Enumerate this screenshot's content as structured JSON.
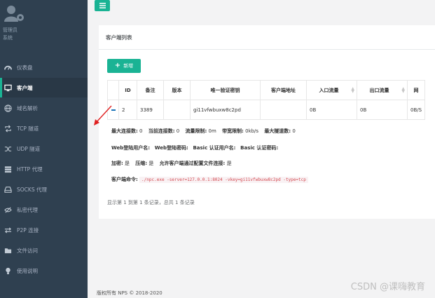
{
  "sidebar": {
    "user_name": "管理员",
    "user_role": "系统",
    "items": [
      {
        "label": "仪表盘",
        "icon": "dashboard-icon"
      },
      {
        "label": "客户端",
        "icon": "desktop-icon",
        "active": true
      },
      {
        "label": "域名解析",
        "icon": "globe-icon"
      },
      {
        "label": "TCP 隧道",
        "icon": "retweet-icon"
      },
      {
        "label": "UDP 隧道",
        "icon": "random-icon"
      },
      {
        "label": "HTTP 代理",
        "icon": "server-icon"
      },
      {
        "label": "SOCKS 代理",
        "icon": "hdd-icon"
      },
      {
        "label": "私密代理",
        "icon": "eye-slash-icon"
      },
      {
        "label": "P2P 连接",
        "icon": "exchange-icon"
      },
      {
        "label": "文件访问",
        "icon": "folder-icon"
      },
      {
        "label": "使用说明",
        "icon": "lightbulb-icon"
      }
    ]
  },
  "panel": {
    "title": "客户端列表",
    "add_label": "新增",
    "columns": [
      "ID",
      "备注",
      "版本",
      "唯一验证密钥",
      "客户端地址",
      "入口流量",
      "出口流量",
      "网"
    ],
    "row": {
      "id": "2",
      "remark": "3389",
      "version": "",
      "vkey": "gi11vfwbuxw8c2pd",
      "address": "",
      "inlet": "0B",
      "outlet": "0B",
      "speed": "0B/S"
    },
    "detail": {
      "max_conn_label": "最大连接数:",
      "max_conn": "0",
      "cur_conn_label": "当前连接数:",
      "cur_conn": "0",
      "flow_limit_label": "流量限制:",
      "flow_limit": "0m",
      "rate_limit_label": "带宽限制:",
      "rate_limit": "0kb/s",
      "max_tunnel_label": "最大隧道数:",
      "max_tunnel": "0",
      "web_user_label": "Web登陆用户名:",
      "web_pass_label": "Web登陆密码:",
      "basic_user_label": "Basic 认证用户名:",
      "basic_pass_label": "Basic 认证密码:",
      "encrypt_label": "加密:",
      "encrypt": "是",
      "compress_label": "压缩:",
      "compress": "是",
      "config_conn_label": "允许客户端通过配置文件连接:",
      "config_conn": "是",
      "cmd_label": "客户端命令:",
      "cmd": "./npc.exe -server=127.0.0.1:8024 -vkey=gi11vfwbuxw8c2pd -type=tcp"
    },
    "summary": "显示第 1 到第 1 条记录，总共 1 条记录"
  },
  "footer": "版权所有 NPS © 2018-2020",
  "watermark": "CSDN @课嗨教育",
  "colors": {
    "sidebar": "#2f4050",
    "accent": "#1ab394",
    "arrow": "#e02020"
  }
}
